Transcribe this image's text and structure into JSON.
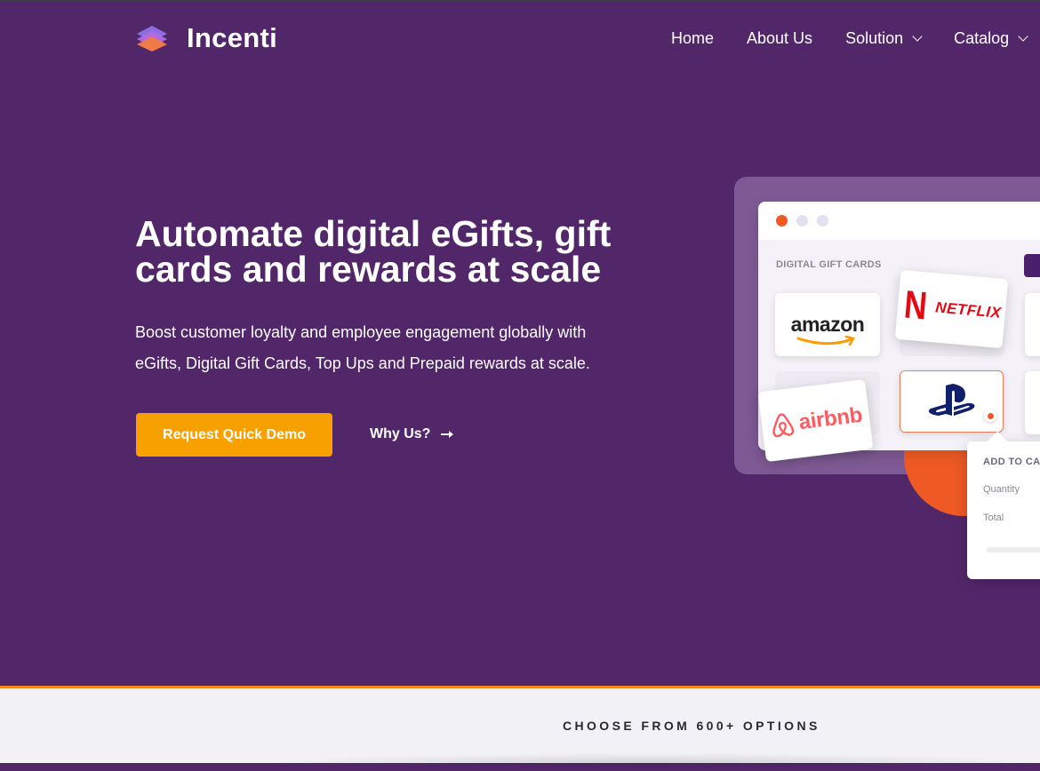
{
  "brand": {
    "name": "Incenti"
  },
  "nav": {
    "items": [
      {
        "label": "Home",
        "has_dropdown": false
      },
      {
        "label": "About Us",
        "has_dropdown": false
      },
      {
        "label": "Solution",
        "has_dropdown": true
      },
      {
        "label": "Catalog",
        "has_dropdown": true
      }
    ]
  },
  "hero": {
    "title": "Automate digital eGifts, gift cards and rewards at scale",
    "subtitle": "Boost customer loyalty and employee engagement globally with eGifts, Digital Gift Cards, Top Ups and Prepaid rewards at scale.",
    "primary_cta": "Request Quick Demo",
    "secondary_cta": "Why Us?"
  },
  "mockup": {
    "section_label": "DIGITAL GIFT CARDS",
    "brands": {
      "amazon": "amazon",
      "netflix": "NETFLIX",
      "airbnb": "airbnb"
    },
    "cart": {
      "title": "ADD TO CART",
      "quantity_label": "Quantity",
      "total_label": "Total"
    },
    "window_dots": [
      "#ef5a24",
      "#e3e0f0",
      "#e3e0f0"
    ]
  },
  "options_section": {
    "heading": "CHOOSE FROM 600+ OPTIONS"
  },
  "colors": {
    "background": "#52276a",
    "accent_orange": "#f7a000",
    "mock_orange": "#ef5a24",
    "divider": "#f38a1f"
  }
}
